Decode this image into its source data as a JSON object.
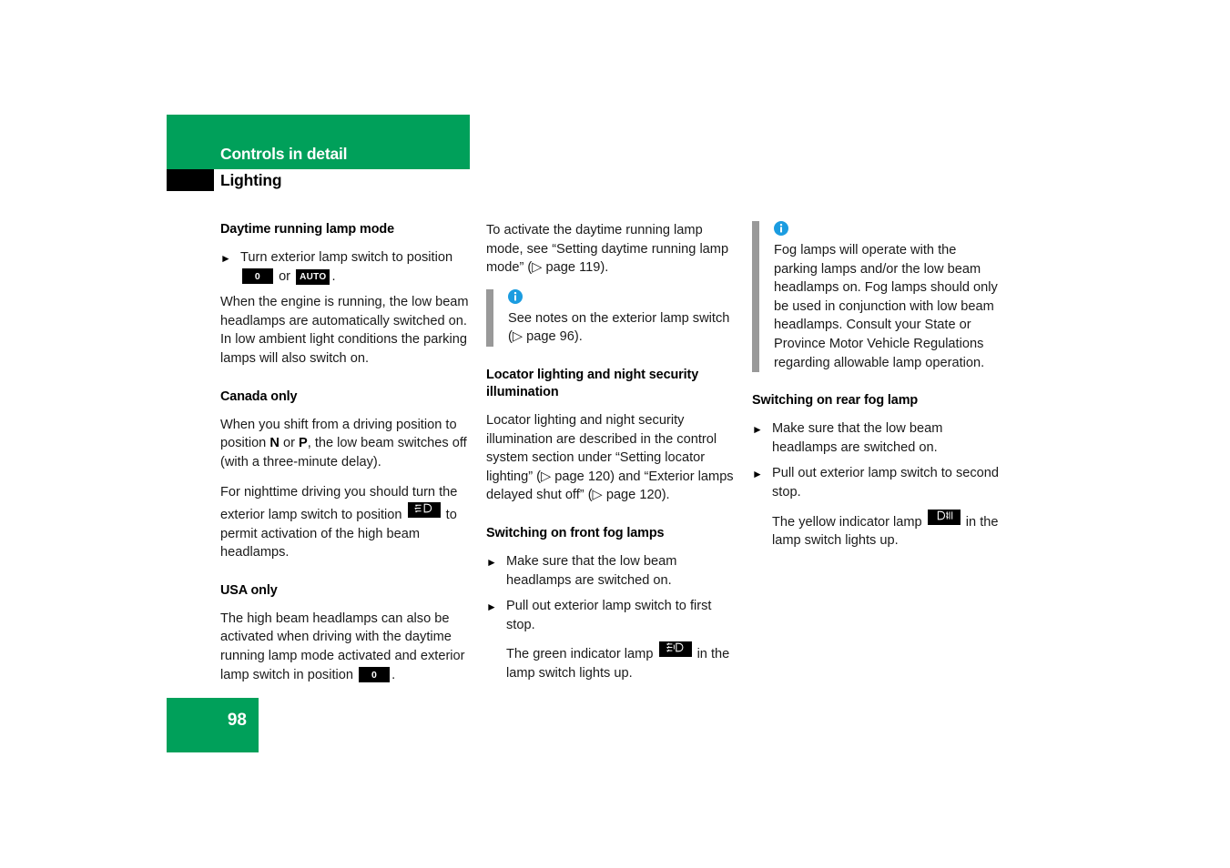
{
  "colors": {
    "brand_green": "#00a05a",
    "black": "#000000",
    "note_bar_gray": "#999999",
    "info_blue": "#1b9ce0"
  },
  "header": {
    "chapter": "Controls in detail",
    "section": "Lighting"
  },
  "footer": {
    "page_number": "98"
  },
  "badges": {
    "pos_0": "0",
    "pos_auto": "AUTO",
    "low_beam_icon": "low-beam-headlamp-icon",
    "front_fog_icon": "front-fog-lamp-icon",
    "rear_fog_icon": "rear-fog-lamp-icon"
  },
  "column1": {
    "heading_daytime": "Daytime running lamp mode",
    "bullet_turn_switch_a": "Turn exterior lamp switch to",
    "bullet_turn_switch_b_pre": "position",
    "bullet_turn_switch_b_mid": "or",
    "bullet_turn_switch_b_post": ".",
    "para_engine_running": "When the engine is running, the low beam headlamps are automatically switched on. In low ambient light conditions the parking lamps will also switch on.",
    "heading_canada": "Canada only",
    "para_canada_1_pre": "When you shift from a driving position to position ",
    "para_canada_1_n": "N",
    "para_canada_1_mid": " or ",
    "para_canada_1_p": "P",
    "para_canada_1_post": ", the low beam switches off (with a three-minute delay).",
    "para_canada_2_pre": "For nighttime driving you should turn the exterior lamp switch to position",
    "para_canada_2_post": "to permit activation of the high beam headlamps.",
    "heading_usa": "USA only",
    "para_usa_pre": "The high beam headlamps can also be activated when driving with the daytime running lamp mode activated and exterior lamp switch in position",
    "para_usa_post": "."
  },
  "column2": {
    "para_activate": "To activate the daytime running lamp mode, see “Setting daytime running lamp mode” (▷ page 119).",
    "note_text": "See notes on the exterior lamp switch (▷ page 96).",
    "heading_locator": "Locator lighting and night security illumination",
    "para_locator": "Locator lighting and night security illumination are described in the control system section under “Setting locator lighting” (▷ page 120) and “Exterior lamps delayed shut off” (▷ page 120).",
    "heading_front_fog": "Switching on front fog lamps",
    "bullet_front_1": "Make sure that the low beam headlamps are switched on.",
    "bullet_front_2": "Pull out exterior lamp switch to first stop.",
    "front_indicator_pre": "The green indicator lamp",
    "front_indicator_post": "in the lamp switch lights up."
  },
  "column3": {
    "note_text": "Fog lamps will operate with the parking lamps and/or the low beam headlamps on. Fog lamps should only be used in conjunction with low beam headlamps. Consult your State or Province Motor Vehicle Regulations regarding allowable lamp operation.",
    "heading_rear_fog": "Switching on rear fog lamp",
    "bullet_rear_1": "Make sure that the low beam headlamps are switched on.",
    "bullet_rear_2": "Pull out exterior lamp switch to second stop.",
    "rear_indicator_pre": "The yellow indicator lamp",
    "rear_indicator_post": "in the lamp switch lights up."
  }
}
